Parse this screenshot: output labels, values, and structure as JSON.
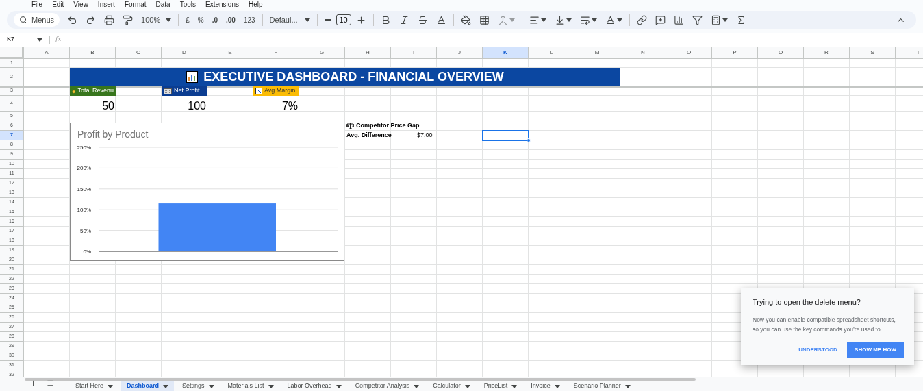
{
  "menu": [
    "File",
    "Edit",
    "View",
    "Insert",
    "Format",
    "Data",
    "Tools",
    "Extensions",
    "Help"
  ],
  "toolbar": {
    "search": "Menus",
    "zoom": "100%",
    "currency": "£",
    "percent": "%",
    "decrease_decimals": ".0",
    "increase_decimals": ".00",
    "number_format": "123",
    "font": "Defaul...",
    "font_size": "10"
  },
  "name_box": "K7",
  "function_label": "fx",
  "columns": [
    {
      "label": "A",
      "selected": false
    },
    {
      "label": "B",
      "selected": false
    },
    {
      "label": "C",
      "selected": false
    },
    {
      "label": "D",
      "selected": false
    },
    {
      "label": "E",
      "selected": false
    },
    {
      "label": "F",
      "selected": false
    },
    {
      "label": "G",
      "selected": false
    },
    {
      "label": "H",
      "selected": false
    },
    {
      "label": "I",
      "selected": false
    },
    {
      "label": "J",
      "selected": false
    },
    {
      "label": "K",
      "selected": true
    },
    {
      "label": "L",
      "selected": false
    },
    {
      "label": "M",
      "selected": false
    },
    {
      "label": "N",
      "selected": false
    },
    {
      "label": "O",
      "selected": false
    },
    {
      "label": "P",
      "selected": false
    },
    {
      "label": "Q",
      "selected": false
    },
    {
      "label": "R",
      "selected": false
    },
    {
      "label": "S",
      "selected": false
    },
    {
      "label": "T",
      "selected": false
    }
  ],
  "rows": [
    {
      "label": "1",
      "selected": false
    },
    {
      "label": "2",
      "selected": false
    },
    {
      "label": "3",
      "selected": false
    },
    {
      "label": "4",
      "selected": false
    },
    {
      "label": "5",
      "selected": false
    },
    {
      "label": "6",
      "selected": false
    },
    {
      "label": "7",
      "selected": true
    },
    {
      "label": "8",
      "selected": false
    },
    {
      "label": "9",
      "selected": false
    },
    {
      "label": "10",
      "selected": false
    },
    {
      "label": "11",
      "selected": false
    },
    {
      "label": "12",
      "selected": false
    },
    {
      "label": "13",
      "selected": false
    },
    {
      "label": "14",
      "selected": false
    },
    {
      "label": "15",
      "selected": false
    },
    {
      "label": "16",
      "selected": false
    },
    {
      "label": "17",
      "selected": false
    },
    {
      "label": "18",
      "selected": false
    },
    {
      "label": "19",
      "selected": false
    },
    {
      "label": "20",
      "selected": false
    },
    {
      "label": "21",
      "selected": false
    },
    {
      "label": "22",
      "selected": false
    },
    {
      "label": "23",
      "selected": false
    },
    {
      "label": "24",
      "selected": false
    },
    {
      "label": "25",
      "selected": false
    },
    {
      "label": "26",
      "selected": false
    },
    {
      "label": "27",
      "selected": false
    },
    {
      "label": "28",
      "selected": false
    },
    {
      "label": "29",
      "selected": false
    },
    {
      "label": "30",
      "selected": false
    },
    {
      "label": "31",
      "selected": false
    },
    {
      "label": "32",
      "selected": false
    }
  ],
  "title_banner": {
    "text": "EXECUTIVE DASHBOARD - FINANCIAL OVERVIEW"
  },
  "kpis": [
    {
      "label": "Total Revenu",
      "value": "50",
      "color": "#38761d"
    },
    {
      "label": "Net Profit",
      "value": "100",
      "color": "#0b3d91"
    },
    {
      "label": "Avg Margin",
      "value": "7%",
      "color": "#fbbc04"
    }
  ],
  "competitor": {
    "heading": "Competitor Price Gap",
    "label": "Avg. Difference",
    "value": "$7.00"
  },
  "chart": {
    "chart_data": {
      "type": "bar",
      "title": "Profit by Product",
      "categories": [
        null
      ],
      "grid": true,
      "series": [
        {
          "color": "#4285f4",
          "values": [
            1.15
          ]
        }
      ],
      "ylim": [
        0,
        2.5
      ],
      "yticks": [
        {
          "value": 0,
          "label": "0%"
        },
        {
          "value": 0.5,
          "label": "50%"
        },
        {
          "value": 1,
          "label": "100%"
        },
        {
          "value": 1.5,
          "label": "150%"
        },
        {
          "value": 2,
          "label": "200%"
        },
        {
          "value": 2.5,
          "label": "250%"
        }
      ]
    }
  },
  "dialog": {
    "title": "Trying to open the delete menu?",
    "body": "Now you can enable compatible spreadsheet shortcuts, so you can use the key commands you’re used to",
    "dismiss": "UNDERSTOOD.",
    "action": "SHOW ME HOW"
  },
  "sheet_tabs": [
    {
      "label": "Start Here",
      "selected": false
    },
    {
      "label": "Dashboard",
      "selected": true
    },
    {
      "label": "Settings",
      "selected": false
    },
    {
      "label": "Materials List",
      "selected": false
    },
    {
      "label": "Labor Overhead",
      "selected": false
    },
    {
      "label": "Competitor Analysis",
      "selected": false
    },
    {
      "label": "Calculator",
      "selected": false
    },
    {
      "label": "PriceList",
      "selected": false
    },
    {
      "label": "Invoice",
      "selected": false
    },
    {
      "label": "Scenario Planner",
      "selected": false
    }
  ]
}
